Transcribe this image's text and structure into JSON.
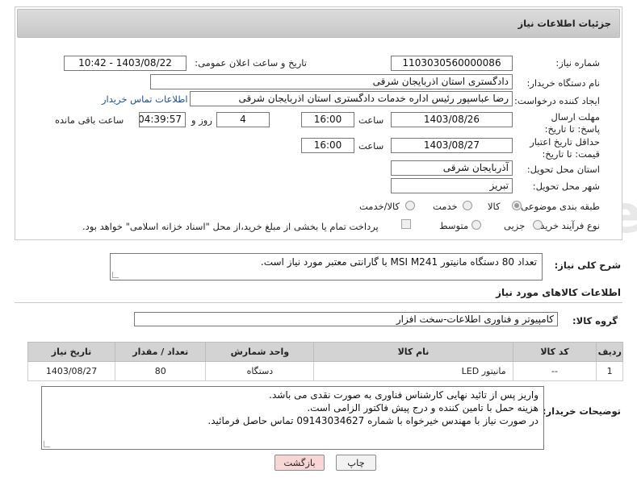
{
  "header": {
    "title": "جزئیات اطلاعات نیاز"
  },
  "fields": {
    "need_number_label": "شماره نیاز:",
    "need_number": "1103030560000086",
    "announce_label": "تاریخ و ساعت اعلان عمومی:",
    "announce_value": "1403/08/22 - 10:42",
    "buyer_label": "نام دستگاه خریدار:",
    "buyer_value": "دادگستری استان اذربایجان شرقی",
    "creator_label": "ایجاد کننده درخواست:",
    "creator_value": "رضا عباسپور رئیس اداره خدمات دادگستری استان اذربایجان شرقی",
    "contact_link": "اطلاعات تماس خریدار",
    "deadline_label": "مهلت ارسال پاسخ: تا تاریخ:",
    "deadline_date": "1403/08/26",
    "time_label": "ساعت",
    "deadline_time": "16:00",
    "days_value": "4",
    "days_label": "روز و",
    "remaining_value": "04:39:57",
    "remaining_label": "ساعت باقی مانده",
    "min_valid_label": "حداقل تاریخ اعتبار قیمت: تا تاریخ:",
    "min_valid_date": "1403/08/27",
    "min_valid_time": "16:00",
    "province_label": "استان محل تحویل:",
    "province_value": "آذربایجان شرقی",
    "city_label": "شهر محل تحویل:",
    "city_value": "تبریز",
    "category_label": "طبقه بندی موضوعی:",
    "category_options": [
      "کالا",
      "خدمت",
      "کالا/خدمت"
    ],
    "category_selected": "کالا",
    "process_label": "نوع فرآیند خرید :",
    "process_options": [
      "جزیی",
      "متوسط"
    ],
    "payment_note": "پرداخت تمام یا بخشی از مبلغ خرید،از محل \"اسناد خزانه اسلامی\" خواهد بود."
  },
  "description": {
    "label": "شرح کلی نیاز:",
    "value": "تعداد 80 دستگاه مانیتور MSI M241 با گارانتی معتبر مورد نیاز است."
  },
  "goods": {
    "section_title": "اطلاعات کالاهای مورد نیاز",
    "group_label": "گروه کالا:",
    "group_value": "کامپیوتر و فناوری اطلاعات-سخت افزار",
    "columns": [
      "ردیف",
      "کد کالا",
      "نام کالا",
      "واحد شمارش",
      "تعداد / مقدار",
      "تاریخ نیاز"
    ],
    "rows": [
      [
        "1",
        "--",
        "مانیتور LED",
        "دستگاه",
        "80",
        "1403/08/27"
      ]
    ]
  },
  "buyer_notes": {
    "label": "توضیحات خریدار:",
    "lines": [
      "واریز پس از تائید نهایی کارشناس فناوری به صورت نقدی می باشد.",
      "هزینه حمل با تامین کننده و درج پیش فاکتور الزامی است.",
      "در صورت نیاز با مهندس خیرخواه با شماره 09143034627 تماس حاصل فرمائید."
    ]
  },
  "buttons": {
    "print": "چاپ",
    "back": "بازگشت"
  },
  "colors": {
    "link": "#1a4fa0",
    "back_button_bg": "#f9d6d6",
    "print_button_bg": "#f2f2f2"
  }
}
